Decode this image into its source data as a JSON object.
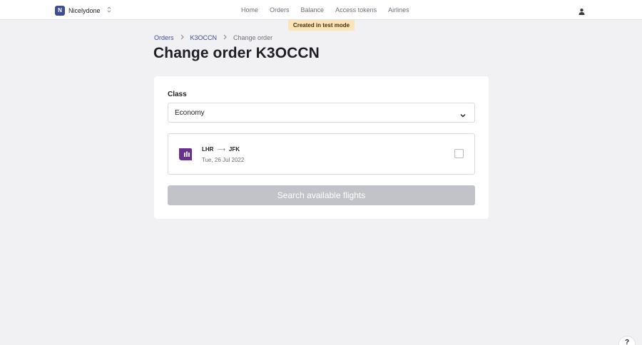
{
  "org": {
    "initial": "N",
    "name": "Nicelydone",
    "switch_icon": "chevron-up-down-icon"
  },
  "nav": {
    "items": [
      "Home",
      "Orders",
      "Balance",
      "Access tokens",
      "Airlines"
    ]
  },
  "user_icon": "person-icon",
  "test_badge": "Created in test mode",
  "breadcrumb": {
    "items": [
      "Orders",
      "K3OCCN",
      "Change order"
    ],
    "separator_icon": "chevron-right-icon"
  },
  "page": {
    "title": "Change order K3OCCN"
  },
  "form": {
    "class_label": "Class",
    "class_value": "Economy",
    "select_icon": "chevron-down-icon",
    "flight": {
      "origin": "LHR",
      "arrow": "⟶",
      "destination": "JFK",
      "date": "Tue, 26 Jul 2022",
      "logo_icon": "airline-logo-icon",
      "checked": false
    },
    "search_label": "Search available flights"
  },
  "help": {
    "label": "?"
  },
  "colors": {
    "accent": "#3f4c8f",
    "badge": "#fbe5b8",
    "disabled_button": "#c2c2c9",
    "background": "#f1f1f3"
  }
}
